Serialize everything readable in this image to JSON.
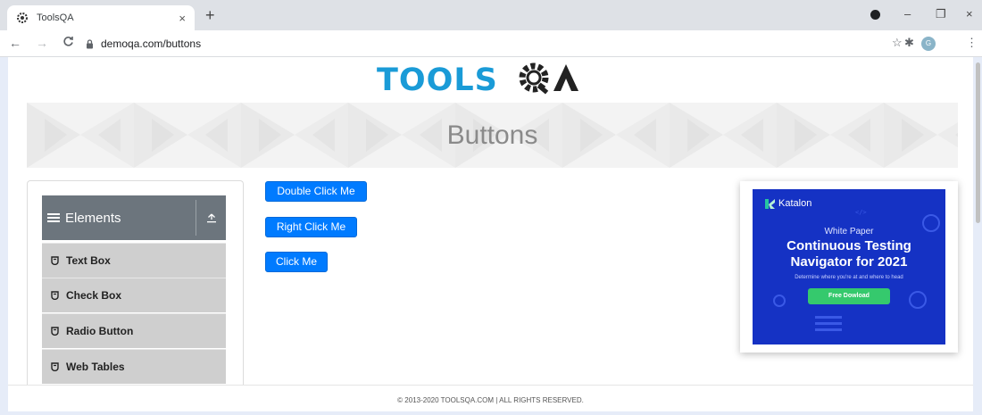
{
  "browser": {
    "tab": {
      "title": "ToolsQA",
      "close_icon": "close-icon"
    },
    "new_tab_icon": "plus-icon",
    "window_controls": {
      "minimize": "–",
      "restore": "❐",
      "close": "×"
    },
    "nav": {
      "back": "←",
      "forward": "→",
      "reload": "C"
    },
    "address": {
      "url": "demoqa.com/buttons"
    },
    "profile_initial": "G"
  },
  "site": {
    "logo_text": "TOOLSQA",
    "page_title": "Buttons",
    "sidebar": {
      "group": "Elements",
      "items": [
        {
          "label": "Text Box"
        },
        {
          "label": "Check Box"
        },
        {
          "label": "Radio Button"
        },
        {
          "label": "Web Tables"
        }
      ]
    },
    "buttons": {
      "double_click": "Double Click Me",
      "right_click": "Right Click Me",
      "click": "Click Me"
    },
    "ad": {
      "brand": "Katalon",
      "kicker": "White Paper",
      "headline_1": "Continuous Testing",
      "headline_2": "Navigator for 2021",
      "subline": "Determine where you're at and where to head",
      "cta": "Free Dowload"
    },
    "footer": "© 2013-2020 TOOLSQA.COM | ALL RIGHTS RESERVED."
  },
  "colors": {
    "primary_button": "#007bff",
    "sidebar_header": "#6c757d",
    "sidebar_item": "#cfcfcf",
    "ad_background": "#1532c4",
    "ad_cta": "#35c96d",
    "logo_blue": "#1a9bd7"
  }
}
